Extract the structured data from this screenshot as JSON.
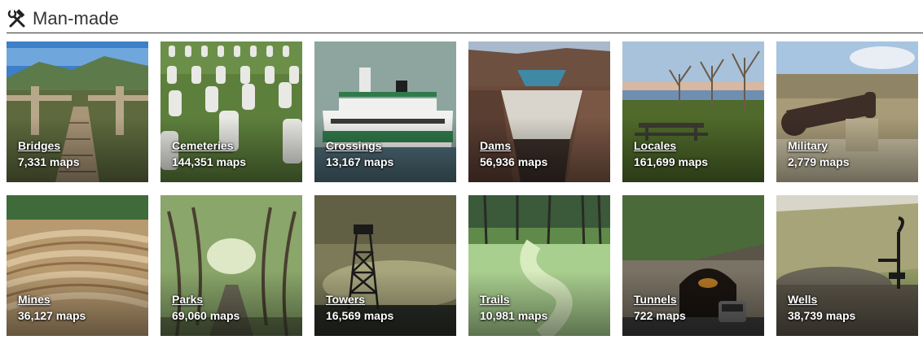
{
  "section": {
    "title": "Man-made",
    "icon": "hammer-wrench-icon"
  },
  "categories": [
    {
      "label": "Bridges",
      "count": "7,331 maps"
    },
    {
      "label": "Cemeteries",
      "count": "144,351 maps"
    },
    {
      "label": "Crossings",
      "count": "13,167 maps"
    },
    {
      "label": "Dams",
      "count": "56,936 maps"
    },
    {
      "label": "Locales",
      "count": "161,699 maps"
    },
    {
      "label": "Military",
      "count": "2,779 maps"
    },
    {
      "label": "Mines",
      "count": "36,127 maps"
    },
    {
      "label": "Parks",
      "count": "69,060 maps"
    },
    {
      "label": "Towers",
      "count": "16,569 maps"
    },
    {
      "label": "Trails",
      "count": "10,981 maps"
    },
    {
      "label": "Tunnels",
      "count": "722 maps"
    },
    {
      "label": "Wells",
      "count": "38,739 maps"
    }
  ],
  "colors": {
    "header_text": "#333333",
    "divider": "#333333",
    "tile_text": "#ffffff"
  }
}
